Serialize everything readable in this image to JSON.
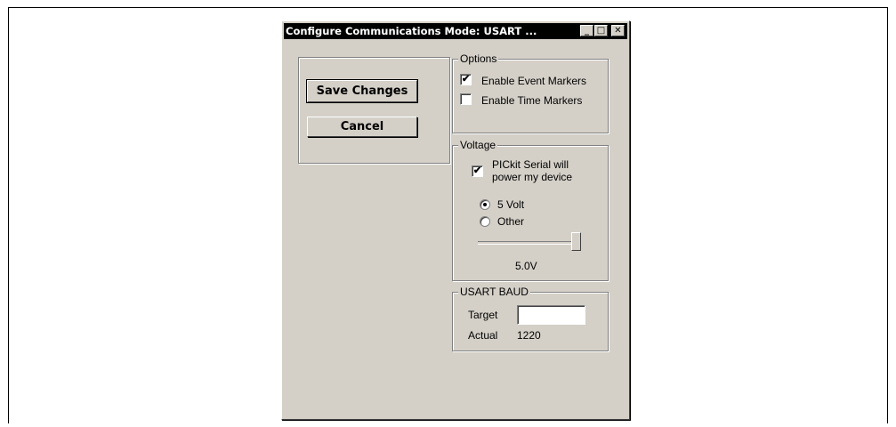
{
  "window": {
    "title": "Configure Communications Mode: USART ...",
    "controls": {
      "minimize": "_",
      "maximize": "□",
      "close": "✕"
    }
  },
  "actions": {
    "save_label": "Save Changes",
    "cancel_label": "Cancel"
  },
  "options": {
    "legend": "Options",
    "event_markers": {
      "label": "Enable Event Markers",
      "checked": true
    },
    "time_markers": {
      "label": "Enable Time Markers",
      "checked": false
    }
  },
  "voltage": {
    "legend": "Voltage",
    "power_device": {
      "label_line1": "PICkit Serial will",
      "label_line2": "power my device",
      "checked": true
    },
    "radio_5v": {
      "label": "5 Volt",
      "selected": true
    },
    "radio_other": {
      "label": "Other",
      "selected": false
    },
    "slider_level": 1.0,
    "value_text": "5.0V"
  },
  "baud": {
    "legend": "USART  BAUD",
    "target_label": "Target",
    "target_value": "",
    "actual_label": "Actual",
    "actual_value": "1220"
  },
  "checkmark_glyph": "✔"
}
